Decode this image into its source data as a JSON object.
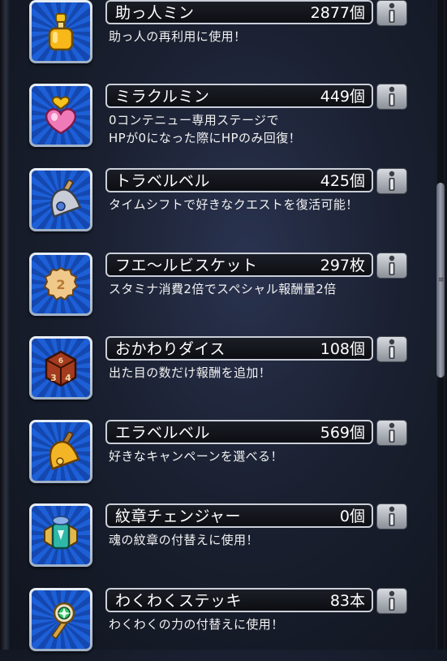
{
  "items": [
    {
      "name": "助っ人ミン",
      "count": "2877個",
      "desc": "助っ人の再利用に使用！",
      "icon": "potion-bottle-icon"
    },
    {
      "name": "ミラクルミン",
      "count": "449個",
      "desc": "0コンテニュー専用ステージで\nHPが0になった際にHPのみ回復！",
      "icon": "heart-potion-icon"
    },
    {
      "name": "トラベルベル",
      "count": "425個",
      "desc": "タイムシフトで好きなクエストを復活可能！",
      "icon": "travel-bell-icon"
    },
    {
      "name": "フエ～ルビスケット",
      "count": "297枚",
      "desc": "スタミナ消費2倍でスペシャル報酬量2倍",
      "icon": "biscuit-icon"
    },
    {
      "name": "おかわりダイス",
      "count": "108個",
      "desc": "出た目の数だけ報酬を追加！",
      "icon": "dice-icon"
    },
    {
      "name": "エラベルベル",
      "count": "569個",
      "desc": "好きなキャンペーンを選べる！",
      "icon": "golden-bell-icon"
    },
    {
      "name": "紋章チェンジャー",
      "count": "0個",
      "desc": "魂の紋章の付替えに使用！",
      "icon": "emblem-changer-icon"
    },
    {
      "name": "わくわくステッキ",
      "count": "83本",
      "desc": "わくわくの力の付替えに使用！",
      "icon": "magic-wand-icon"
    }
  ]
}
